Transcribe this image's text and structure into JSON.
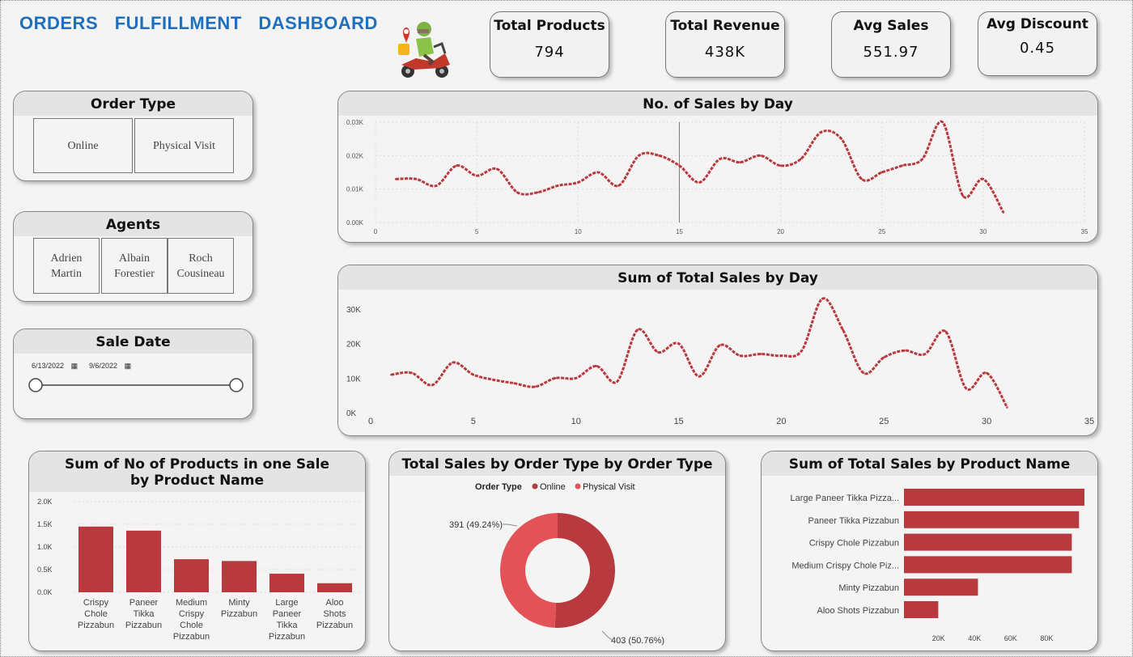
{
  "header": {
    "title": "ORDERS FULFILLMENT DASHBOARD"
  },
  "kpis": [
    {
      "label": "Total Products",
      "value": "794"
    },
    {
      "label": "Total Revenue",
      "value": "438K"
    },
    {
      "label": "Avg Sales",
      "value": "551.97"
    },
    {
      "label": "Avg Discount",
      "value": "0.45"
    }
  ],
  "slicers": {
    "order_type": {
      "title": "Order Type",
      "options": [
        "Online",
        "Physical Visit"
      ]
    },
    "agents": {
      "title": "Agents",
      "options": [
        "Adrien Martin",
        "Albain Forestier",
        "Roch Cousineau"
      ]
    },
    "sale_date": {
      "title": "Sale Date",
      "start": "6/13/2022",
      "end": "9/6/2022"
    }
  },
  "colors": {
    "series": "#b83a3f",
    "online": "#b83a3f",
    "physical": "#e35257",
    "title_blue": "#1f6fbf"
  },
  "icons": {
    "scooter": "delivery-scooter-icon",
    "calendar": "calendar-icon"
  },
  "chart_data": [
    {
      "id": "sales_count",
      "type": "line",
      "title": "No. of Sales by Day",
      "xlabel": "",
      "ylabel": "",
      "xlim": [
        0,
        35
      ],
      "ylim": [
        0,
        30
      ],
      "x_ticks": [
        0,
        5,
        10,
        15,
        20,
        25,
        30,
        35
      ],
      "y_ticks": [
        "0.00K",
        "0.01K",
        "0.02K",
        "0.03K"
      ],
      "grid": true,
      "reference_x": 15,
      "x": [
        1,
        2,
        3,
        4,
        5,
        6,
        7,
        8,
        9,
        10,
        11,
        12,
        13,
        14,
        15,
        16,
        17,
        18,
        19,
        20,
        21,
        22,
        23,
        24,
        25,
        26,
        27,
        28,
        29,
        30,
        31
      ],
      "y": [
        13,
        13,
        11,
        17,
        14,
        16,
        9,
        9,
        11,
        12,
        15,
        11,
        20,
        20,
        17,
        12,
        19,
        18,
        20,
        17,
        19,
        27,
        25,
        13,
        15,
        17,
        19,
        30,
        8,
        13,
        3
      ]
    },
    {
      "id": "sales_sum",
      "type": "line",
      "title": "Sum of Total Sales by Day",
      "xlabel": "",
      "ylabel": "",
      "xlim": [
        0,
        35
      ],
      "ylim": [
        0,
        30000
      ],
      "x_ticks": [
        0,
        5,
        10,
        15,
        20,
        25,
        30,
        35
      ],
      "y_ticks": [
        "0K",
        "10K",
        "20K",
        "30K"
      ],
      "grid": false,
      "x": [
        1,
        2,
        3,
        4,
        5,
        6,
        7,
        8,
        9,
        10,
        11,
        12,
        13,
        14,
        15,
        16,
        17,
        18,
        19,
        20,
        21,
        22,
        23,
        24,
        25,
        26,
        27,
        28,
        29,
        30,
        31
      ],
      "y": [
        11000,
        11500,
        8000,
        14500,
        11000,
        9500,
        8500,
        7500,
        10000,
        10000,
        13500,
        9000,
        24000,
        17500,
        20000,
        10500,
        19500,
        16500,
        17000,
        16500,
        18000,
        33000,
        24000,
        11500,
        16000,
        18000,
        17000,
        23500,
        7000,
        11500,
        1500
      ]
    },
    {
      "id": "products_per_sale",
      "type": "bar",
      "title": "Sum of No of Products in one Sale by Product Name",
      "xlabel": "",
      "ylabel": "",
      "ylim": [
        0,
        2000
      ],
      "y_ticks": [
        "0.0K",
        "0.5K",
        "1.0K",
        "1.5K",
        "2.0K"
      ],
      "categories": [
        "Crispy Chole Pizzabun",
        "Paneer Tikka Pizzabun",
        "Medium Crispy Chole Pizzabun",
        "Minty Pizzabun",
        "Large Paneer Tikka Pizzabun",
        "Aloo Shots Pizzabun"
      ],
      "category_lines": [
        [
          "Crispy",
          "Chole",
          "Pizzabun"
        ],
        [
          "Paneer",
          "Tikka",
          "Pizzabun"
        ],
        [
          "Medium",
          "Crispy",
          "Chole",
          "Pizzabun"
        ],
        [
          "Minty",
          "Pizzabun"
        ],
        [
          "Large",
          "Paneer",
          "Tikka",
          "Pizzabun"
        ],
        [
          "Aloo",
          "Shots",
          "Pizzabun"
        ]
      ],
      "values": [
        1450,
        1360,
        730,
        690,
        410,
        200
      ]
    },
    {
      "id": "order_type_share",
      "type": "pie",
      "title": "Total Sales by Order Type by Order Type",
      "legend_title": "Order Type",
      "legend_position": "top",
      "labels": [
        "Online",
        "Physical Visit"
      ],
      "values": [
        403,
        391
      ],
      "data_labels": [
        "403 (50.76%)",
        "391 (49.24%)"
      ],
      "donut": true
    },
    {
      "id": "sales_by_product",
      "type": "bar",
      "orientation": "horizontal",
      "title": "Sum of Total Sales by Product Name",
      "xlabel": "",
      "ylabel": "",
      "xlim": [
        0,
        100000
      ],
      "x_ticks": [
        "20K",
        "40K",
        "60K",
        "80K"
      ],
      "categories": [
        "Large Paneer Tikka Pizza...",
        "Paneer Tikka Pizzabun",
        "Crispy Chole Pizzabun",
        "Medium Crispy Chole Piz...",
        "Minty Pizzabun",
        "Aloo Shots Pizzabun"
      ],
      "values": [
        100000,
        97000,
        93000,
        93000,
        41000,
        19000
      ]
    }
  ]
}
